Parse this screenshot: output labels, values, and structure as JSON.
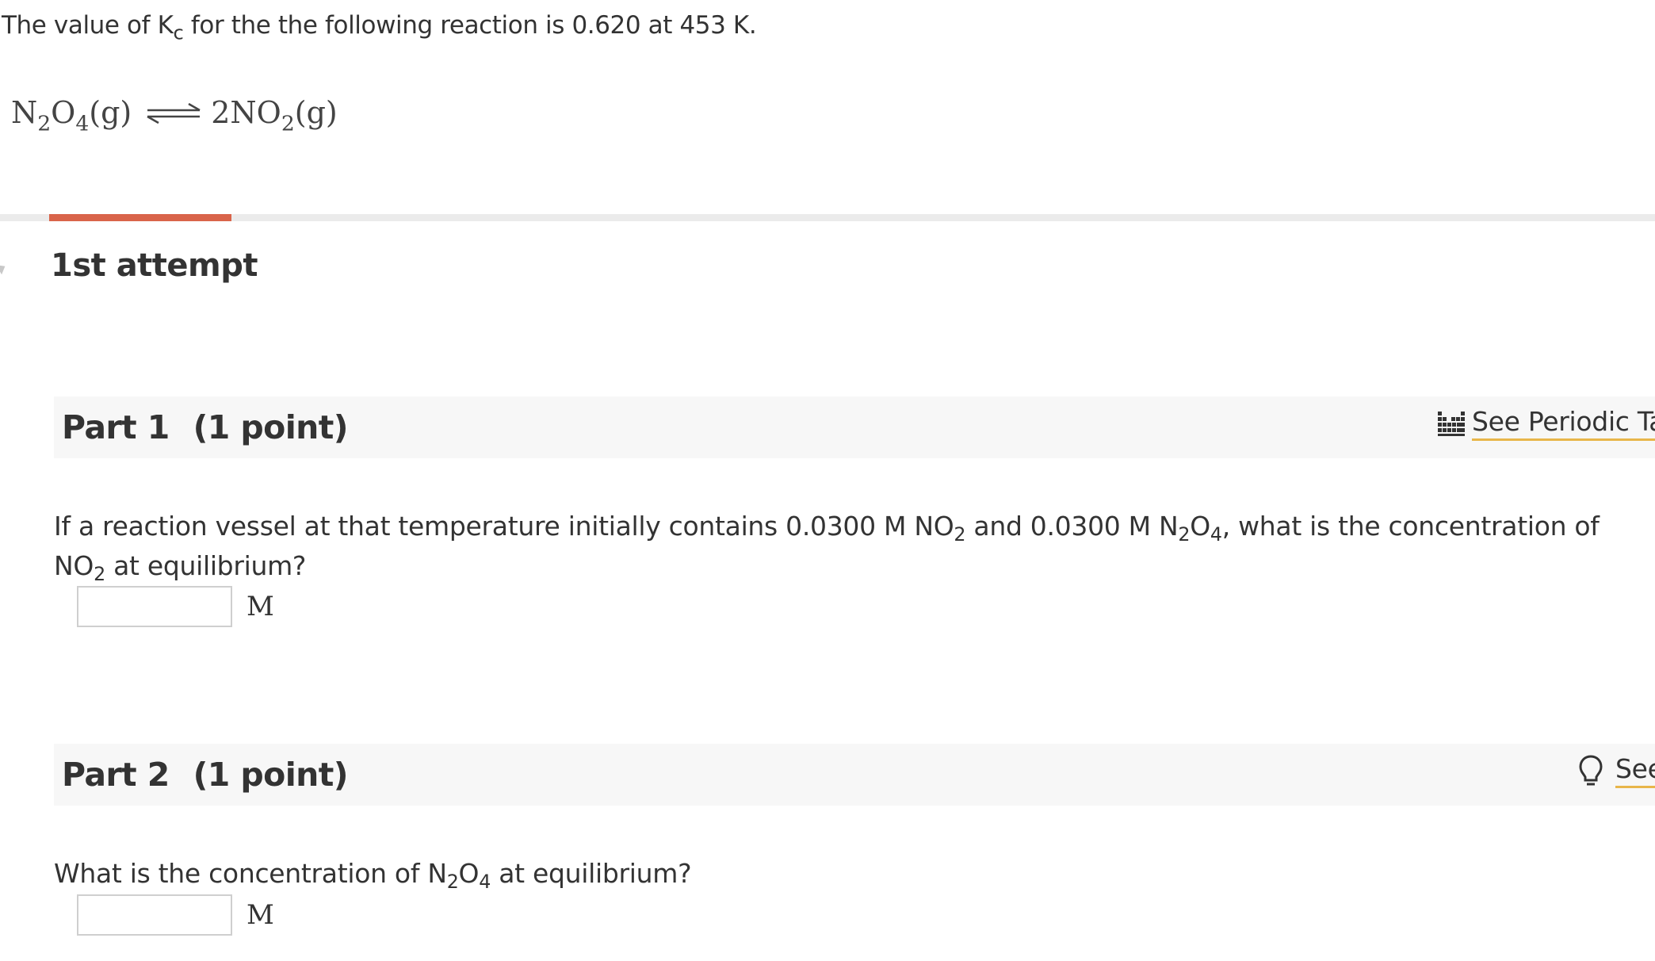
{
  "intro": {
    "prefix": "The value of K",
    "kc_sub": "c",
    "suffix": "for the the following reaction is 0.620 at  453 K."
  },
  "equation": {
    "reactant_a": "N",
    "reactant_a_sub": "2",
    "reactant_b": "O",
    "reactant_b_sub": "4",
    "reactant_state": "(g)",
    "product_a": "2NO",
    "product_a_sub": "2",
    "product_state": "(g)"
  },
  "attempt": {
    "title": "1st attempt"
  },
  "part1": {
    "label": "Part 1",
    "points": "(1 point)",
    "tool_label": "See Periodic Ta",
    "tool_icon": "periodic-table-icon",
    "question": {
      "t1": "If a reaction vessel at that temperature initially contains 0.0300  M NO",
      "s1": "2",
      "t2": " and 0.0300  M N",
      "s2": "2",
      "t3": "O",
      "s3": "4",
      "t4": ", what is the concentration of NO",
      "s4": "2",
      "t5": " at equilibrium?"
    },
    "input_value": "",
    "unit": "M"
  },
  "part2": {
    "label": "Part 2",
    "points": "(1 point)",
    "tool_label": "See",
    "tool_icon": "lightbulb-icon",
    "question": {
      "t1": "What is the concentration of N",
      "s1": "2",
      "t2": "O",
      "s2": "4",
      "t3": " at equilibrium?"
    },
    "input_value": "",
    "unit": "M"
  },
  "colors": {
    "accent_tab": "#d9644a",
    "link_underline": "#e8b64a",
    "header_bg": "#f7f7f7"
  }
}
